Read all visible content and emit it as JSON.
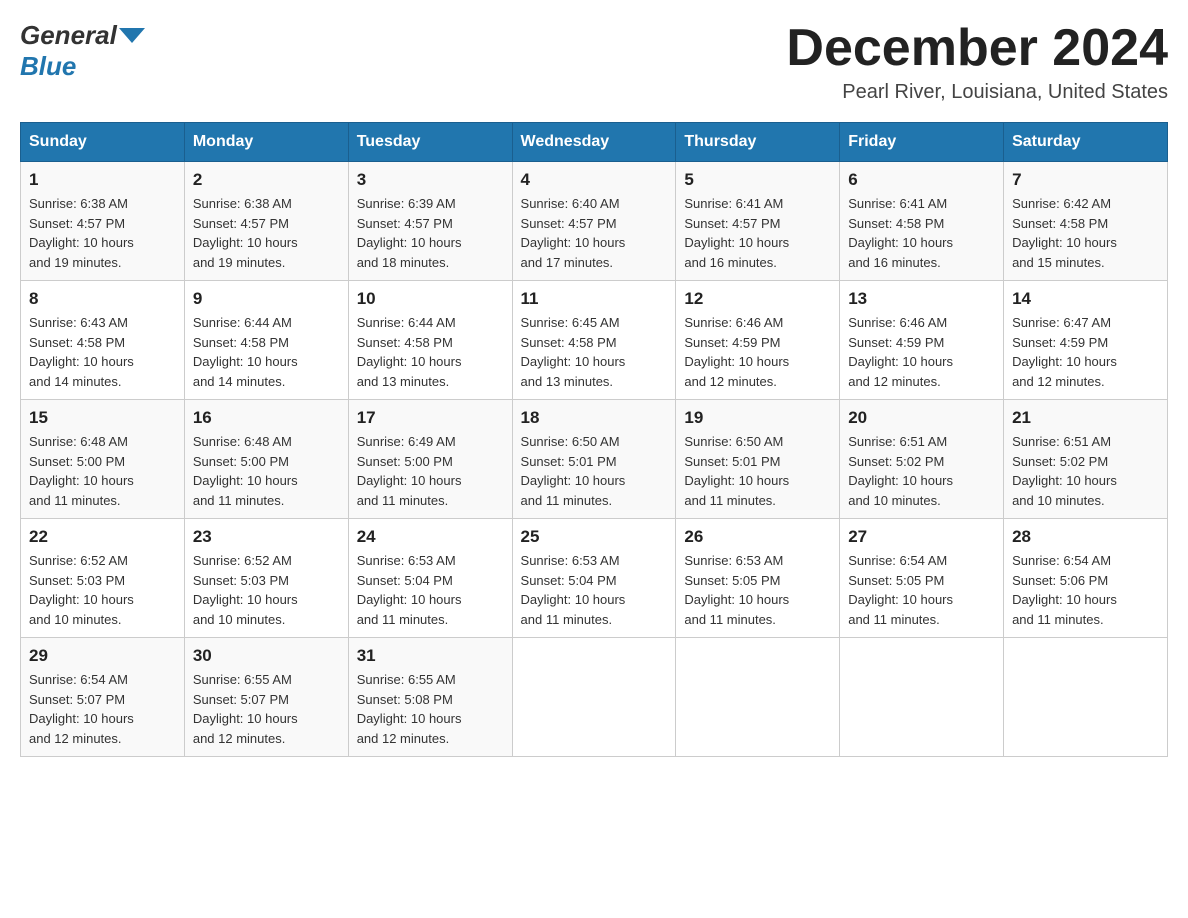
{
  "header": {
    "logo_line1": "General",
    "logo_triangle": "▶",
    "logo_line2": "Blue",
    "month_title": "December 2024",
    "location": "Pearl River, Louisiana, United States"
  },
  "days_of_week": [
    "Sunday",
    "Monday",
    "Tuesday",
    "Wednesday",
    "Thursday",
    "Friday",
    "Saturday"
  ],
  "weeks": [
    [
      {
        "day": "1",
        "sunrise": "6:38 AM",
        "sunset": "4:57 PM",
        "daylight": "10 hours and 19 minutes."
      },
      {
        "day": "2",
        "sunrise": "6:38 AM",
        "sunset": "4:57 PM",
        "daylight": "10 hours and 19 minutes."
      },
      {
        "day": "3",
        "sunrise": "6:39 AM",
        "sunset": "4:57 PM",
        "daylight": "10 hours and 18 minutes."
      },
      {
        "day": "4",
        "sunrise": "6:40 AM",
        "sunset": "4:57 PM",
        "daylight": "10 hours and 17 minutes."
      },
      {
        "day": "5",
        "sunrise": "6:41 AM",
        "sunset": "4:57 PM",
        "daylight": "10 hours and 16 minutes."
      },
      {
        "day": "6",
        "sunrise": "6:41 AM",
        "sunset": "4:58 PM",
        "daylight": "10 hours and 16 minutes."
      },
      {
        "day": "7",
        "sunrise": "6:42 AM",
        "sunset": "4:58 PM",
        "daylight": "10 hours and 15 minutes."
      }
    ],
    [
      {
        "day": "8",
        "sunrise": "6:43 AM",
        "sunset": "4:58 PM",
        "daylight": "10 hours and 14 minutes."
      },
      {
        "day": "9",
        "sunrise": "6:44 AM",
        "sunset": "4:58 PM",
        "daylight": "10 hours and 14 minutes."
      },
      {
        "day": "10",
        "sunrise": "6:44 AM",
        "sunset": "4:58 PM",
        "daylight": "10 hours and 13 minutes."
      },
      {
        "day": "11",
        "sunrise": "6:45 AM",
        "sunset": "4:58 PM",
        "daylight": "10 hours and 13 minutes."
      },
      {
        "day": "12",
        "sunrise": "6:46 AM",
        "sunset": "4:59 PM",
        "daylight": "10 hours and 12 minutes."
      },
      {
        "day": "13",
        "sunrise": "6:46 AM",
        "sunset": "4:59 PM",
        "daylight": "10 hours and 12 minutes."
      },
      {
        "day": "14",
        "sunrise": "6:47 AM",
        "sunset": "4:59 PM",
        "daylight": "10 hours and 12 minutes."
      }
    ],
    [
      {
        "day": "15",
        "sunrise": "6:48 AM",
        "sunset": "5:00 PM",
        "daylight": "10 hours and 11 minutes."
      },
      {
        "day": "16",
        "sunrise": "6:48 AM",
        "sunset": "5:00 PM",
        "daylight": "10 hours and 11 minutes."
      },
      {
        "day": "17",
        "sunrise": "6:49 AM",
        "sunset": "5:00 PM",
        "daylight": "10 hours and 11 minutes."
      },
      {
        "day": "18",
        "sunrise": "6:50 AM",
        "sunset": "5:01 PM",
        "daylight": "10 hours and 11 minutes."
      },
      {
        "day": "19",
        "sunrise": "6:50 AM",
        "sunset": "5:01 PM",
        "daylight": "10 hours and 11 minutes."
      },
      {
        "day": "20",
        "sunrise": "6:51 AM",
        "sunset": "5:02 PM",
        "daylight": "10 hours and 10 minutes."
      },
      {
        "day": "21",
        "sunrise": "6:51 AM",
        "sunset": "5:02 PM",
        "daylight": "10 hours and 10 minutes."
      }
    ],
    [
      {
        "day": "22",
        "sunrise": "6:52 AM",
        "sunset": "5:03 PM",
        "daylight": "10 hours and 10 minutes."
      },
      {
        "day": "23",
        "sunrise": "6:52 AM",
        "sunset": "5:03 PM",
        "daylight": "10 hours and 10 minutes."
      },
      {
        "day": "24",
        "sunrise": "6:53 AM",
        "sunset": "5:04 PM",
        "daylight": "10 hours and 11 minutes."
      },
      {
        "day": "25",
        "sunrise": "6:53 AM",
        "sunset": "5:04 PM",
        "daylight": "10 hours and 11 minutes."
      },
      {
        "day": "26",
        "sunrise": "6:53 AM",
        "sunset": "5:05 PM",
        "daylight": "10 hours and 11 minutes."
      },
      {
        "day": "27",
        "sunrise": "6:54 AM",
        "sunset": "5:05 PM",
        "daylight": "10 hours and 11 minutes."
      },
      {
        "day": "28",
        "sunrise": "6:54 AM",
        "sunset": "5:06 PM",
        "daylight": "10 hours and 11 minutes."
      }
    ],
    [
      {
        "day": "29",
        "sunrise": "6:54 AM",
        "sunset": "5:07 PM",
        "daylight": "10 hours and 12 minutes."
      },
      {
        "day": "30",
        "sunrise": "6:55 AM",
        "sunset": "5:07 PM",
        "daylight": "10 hours and 12 minutes."
      },
      {
        "day": "31",
        "sunrise": "6:55 AM",
        "sunset": "5:08 PM",
        "daylight": "10 hours and 12 minutes."
      },
      null,
      null,
      null,
      null
    ]
  ],
  "labels": {
    "sunrise": "Sunrise:",
    "sunset": "Sunset:",
    "daylight": "Daylight:"
  }
}
